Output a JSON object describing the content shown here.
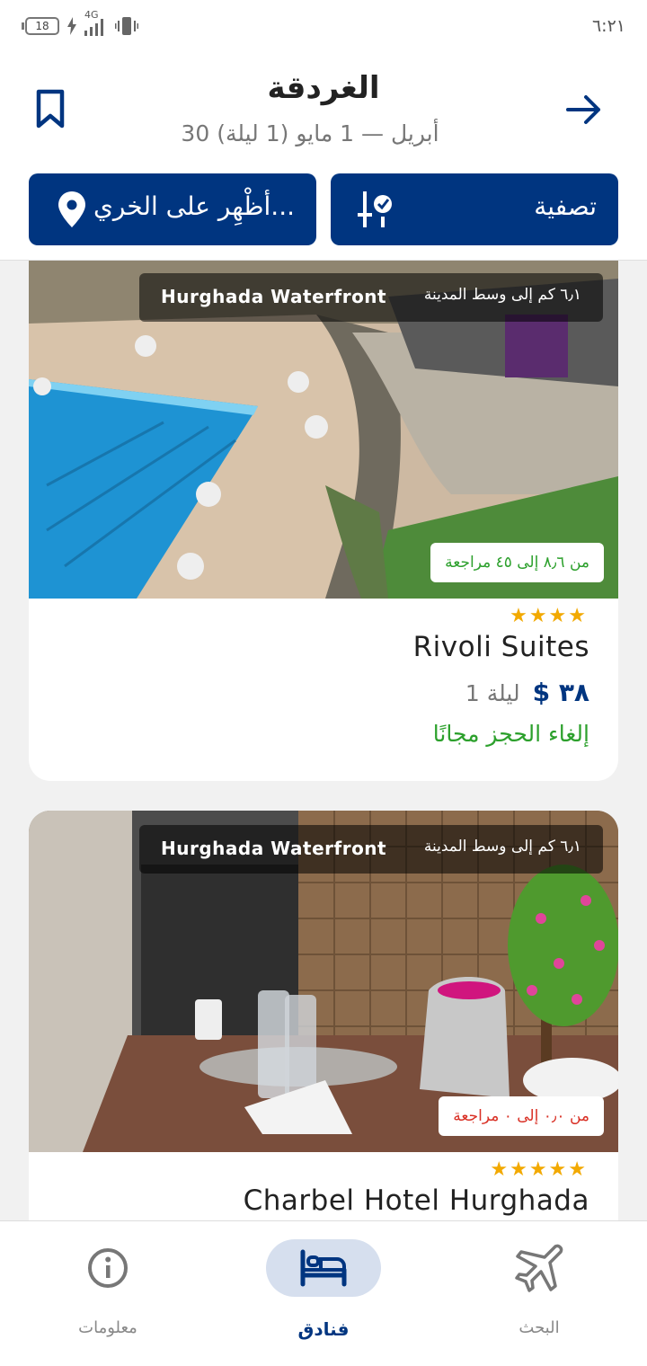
{
  "status_bar": {
    "battery": "18",
    "network": "4G",
    "time": "٦:٢١"
  },
  "header": {
    "title": "الغردقة",
    "subtitle": "30 أبريل — 1 مايو (1 ليلة)",
    "filter_label": "تصفية",
    "map_label": "أظْهِر على الخري...",
    "back_icon": "arrow-right-icon",
    "bookmark_icon": "bookmark-icon"
  },
  "hotels": [
    {
      "location_tag": "Hurghada Waterfront",
      "distance": "٦٫١ كم إلى وسط المدينة",
      "review": "من ٨٫٦ إلى ٤٥ مراجعة",
      "review_color": "#2ca02c",
      "stars": "★★★★",
      "star_count": 4,
      "name": "Rivoli Suites",
      "price": "$ ٣٨",
      "nights": "1 ليلة",
      "cancellation": "إلغاء الحجز مجانًا"
    },
    {
      "location_tag": "Hurghada Waterfront",
      "distance": "٦٫١ كم إلى وسط المدينة",
      "review": "من ٠٫٠ إلى ٠ مراجعة",
      "review_color": "#d93025",
      "stars": "★★★★★",
      "star_count": 5,
      "name": "Charbel Hotel Hurghada"
    }
  ],
  "bottom_nav": {
    "items": [
      {
        "label": "معلومات",
        "icon": "info-icon"
      },
      {
        "label": "فنادق",
        "icon": "bed-icon",
        "active": true
      },
      {
        "label": "البحث",
        "icon": "airplane-icon"
      }
    ]
  },
  "colors": {
    "brand": "#003580",
    "star": "#f2a900",
    "success": "#2ca02c",
    "danger": "#d93025"
  }
}
